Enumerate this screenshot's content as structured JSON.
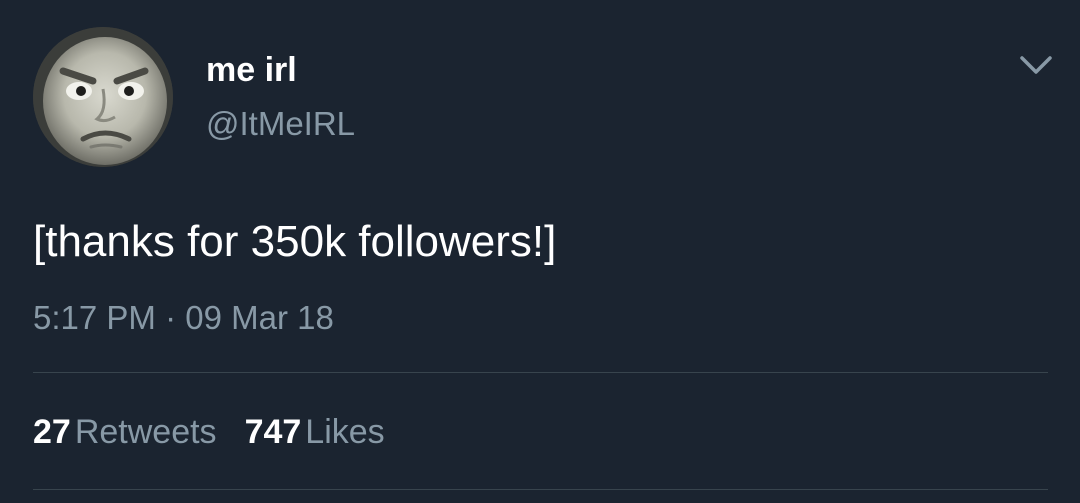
{
  "user": {
    "display_name": "me irl",
    "handle": "@ItMeIRL",
    "avatar_icon": "angry-face-avatar"
  },
  "tweet": {
    "text": "[thanks for 350k followers!]",
    "timestamp": "5:17 PM · 09 Mar 18"
  },
  "stats": {
    "retweets_count": "27",
    "retweets_label": "Retweets",
    "likes_count": "747",
    "likes_label": "Likes"
  },
  "icons": {
    "menu": "chevron-down-icon"
  },
  "colors": {
    "background": "#1b2430",
    "primary_text": "#ffffff",
    "secondary_text": "#8899a6",
    "divider": "#38444d"
  }
}
